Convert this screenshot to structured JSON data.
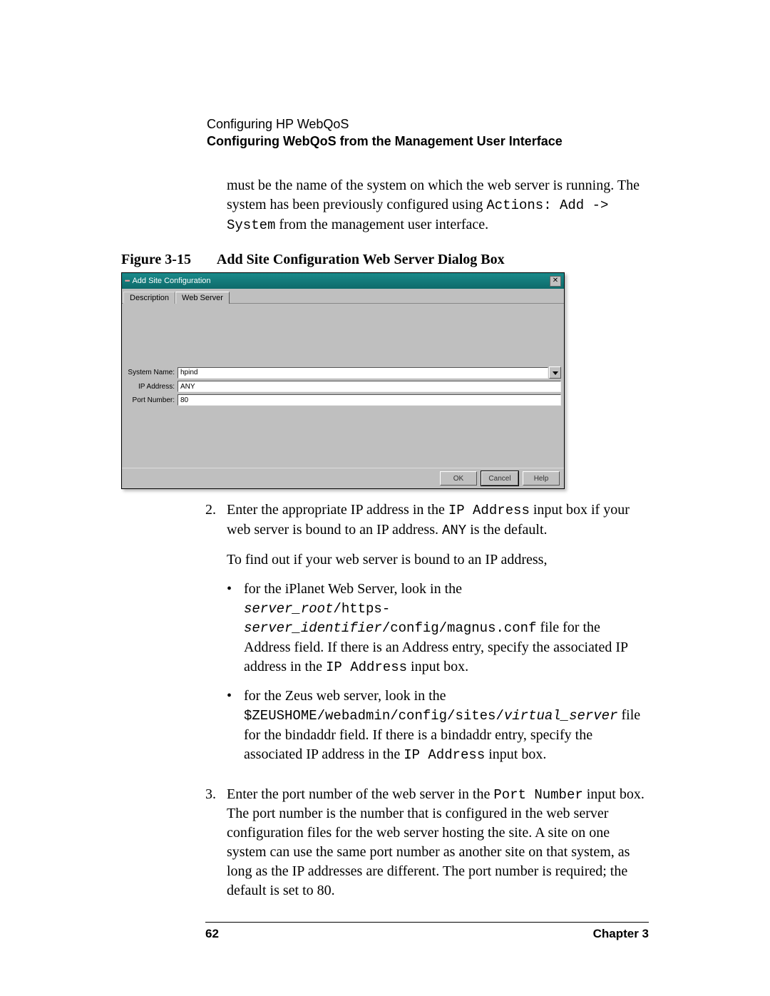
{
  "header": {
    "line1": "Configuring HP WebQoS",
    "line2": "Configuring WebQoS from the Management User Interface"
  },
  "intro": {
    "pre": "must be the name of the system on which the web server is running. The system has been previously configured using ",
    "code": "Actions: Add -> System",
    "post": " from the management user interface."
  },
  "figure": {
    "label": "Figure 3-15",
    "caption": "Add Site Configuration Web Server Dialog Box"
  },
  "dialog": {
    "title": "Add Site Configuration",
    "close_symbol": "✕",
    "tabs": {
      "description": "Description",
      "webserver": "Web Server"
    },
    "fields": {
      "system_label": "System Name:",
      "system_value": "hpind",
      "ip_label": "IP Address:",
      "ip_value": "ANY",
      "port_label": "Port Number:",
      "port_value": "80"
    },
    "buttons": {
      "ok": "OK",
      "cancel": "Cancel",
      "help": "Help"
    }
  },
  "step2": {
    "num": "2.",
    "line1_a": "Enter the appropriate IP address in the ",
    "line1_code": "IP Address",
    "line1_b": " input box if your web server is bound to an IP address. ",
    "line1_code2": "ANY",
    "line1_c": " is the default.",
    "line2": "To find out if your web server is bound to an IP address,",
    "bullet1": {
      "a": "for the iPlanet Web Server, look in the ",
      "path_a": "server_root",
      "path_b": "/https-",
      "path_c": "server_identifier",
      "path_d": "/config/magnus.conf",
      "b": "file for the Address field. If there is an Address entry, specify the associated IP address in the ",
      "code": "IP Address",
      "c": " input box."
    },
    "bullet2": {
      "a": "for the Zeus web server, look in the ",
      "path_a": "$ZEUSHOME/webadmin/config/sites/",
      "path_b": "virtual_server",
      "b": " file for the bindaddr field. If there is a bindaddr entry, specify the associated IP address in the ",
      "code": "IP Address",
      "c": " input box."
    }
  },
  "step3": {
    "num": "3.",
    "a": "Enter the port number of the web server in the ",
    "code": "Port Number",
    "b": " input box. The port number is the number that is configured in the web server configuration files for the web server hosting the site. A site on one system can use the same port number as another site on that system, as long as the IP addresses are different. The port number is required; the default is set to 80."
  },
  "footer": {
    "page": "62",
    "chapter": "Chapter 3"
  }
}
